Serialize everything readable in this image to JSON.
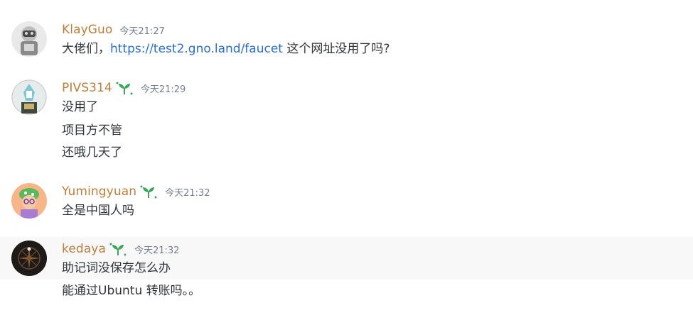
{
  "colors": {
    "username": "#b97f3f",
    "link": "#2d6fc4",
    "timestamp": "#747f8d",
    "text": "#2e3338",
    "hover_bg": "#f8f8f8",
    "badge": "#3ba55c"
  },
  "messages": [
    {
      "username": "KlayGuo",
      "timestamp": "今天21:27",
      "has_badge": false,
      "lines": [
        {
          "before": "大佬们，",
          "link": "https://test2.gno.land/faucet",
          "after": " 这个网址没用了吗?"
        }
      ]
    },
    {
      "username": "PIVS314",
      "timestamp": "今天21:29",
      "has_badge": true,
      "badge_icon": "sprout-icon",
      "lines": [
        "没用了",
        "项目方不管",
        "还哦几天了"
      ]
    },
    {
      "username": "Yumingyuan",
      "timestamp": "今天21:32",
      "has_badge": true,
      "badge_icon": "sprout-icon",
      "lines": [
        "全是中国人吗"
      ]
    },
    {
      "username": "kedaya",
      "timestamp": "今天21:32",
      "has_badge": true,
      "badge_icon": "sprout-icon",
      "lines": [
        "助记词没保存怎么办",
        "能通过Ubuntu 转账吗。。"
      ]
    }
  ]
}
